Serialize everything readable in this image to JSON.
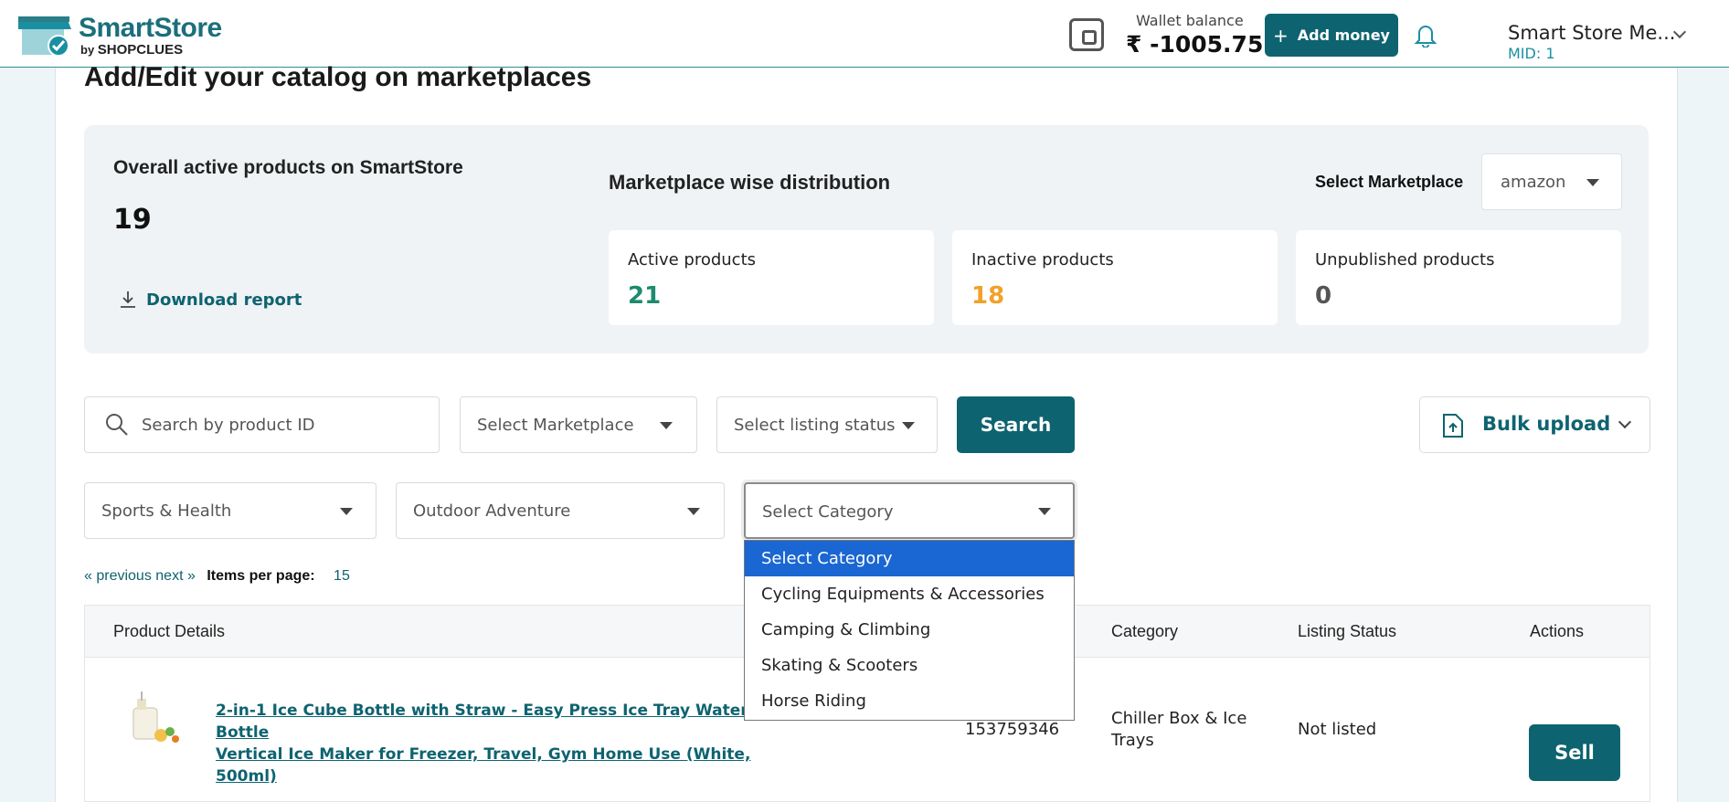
{
  "header": {
    "logo_text": "SmartStore",
    "logo_by": "by",
    "logo_brand": "SHOPCLUES",
    "wallet_label": "Wallet balance",
    "wallet_amount": "₹ -1005.75",
    "add_money_plus": "+",
    "add_money_label": "Add money",
    "merchant_name": "Smart Store Me...",
    "merchant_mid": "MID: 1"
  },
  "page": {
    "title": "Add/Edit your catalog on marketplaces"
  },
  "summary": {
    "overall_label": "Overall active products on SmartStore",
    "overall_value": "19",
    "download_label": "Download report",
    "distribution_title": "Marketplace wise distribution",
    "select_marketplace_label": "Select Marketplace",
    "selected_marketplace": "amazon",
    "stats": [
      {
        "label": "Active products",
        "value": "21",
        "color": "#1e8a6e"
      },
      {
        "label": "Inactive products",
        "value": "18",
        "color": "#f2a12a"
      },
      {
        "label": "Unpublished products",
        "value": "0",
        "color": "#555555"
      }
    ]
  },
  "filters": {
    "search_placeholder": "Search by product ID",
    "marketplace_placeholder": "Select Marketplace",
    "listing_status_placeholder": "Select listing status",
    "search_button": "Search",
    "bulk_upload": "Bulk upload",
    "category_level1": "Sports & Health",
    "category_level2": "Outdoor Adventure",
    "category_level3": "Select Category"
  },
  "category_dropdown": {
    "options": [
      "Select Category",
      "Cycling Equipments & Accessories",
      "Camping & Climbing",
      "Skating & Scooters",
      "Horse Riding"
    ],
    "selected_index": 0
  },
  "pagination": {
    "previous": "« previous",
    "next": "next »",
    "items_per_page_label": "Items per page:",
    "items_per_page_value": "15"
  },
  "table": {
    "columns": [
      "Product Details",
      "Category",
      "Listing Status",
      "Actions"
    ],
    "rows": [
      {
        "title_line1": "2-in-1 Ice Cube Bottle with Straw - Easy Press Ice Tray Water Bottle",
        "title_line2": "Vertical Ice Maker for Freezer, Travel, Gym Home Use (White, 500ml)",
        "product_id": "153759346",
        "category_line1": "Chiller Box & Ice",
        "category_line2": "Trays",
        "listing_status": "Not listed",
        "action": "Sell"
      }
    ]
  },
  "colors": {
    "brand": "#0e6370",
    "accent_blue": "#1b8fa2",
    "dropdown_highlight": "#1a66d2"
  }
}
